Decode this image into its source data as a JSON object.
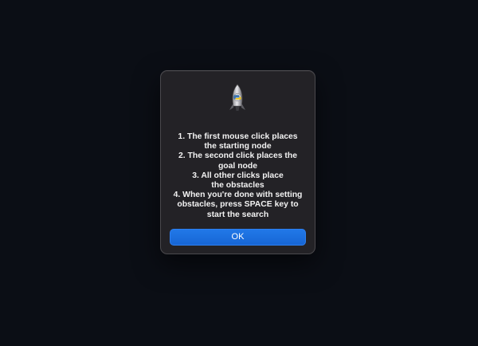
{
  "dialog": {
    "icon": "python-rocket-icon",
    "message_lines": [
      "1. The first mouse click places",
      "the starting node",
      "2. The second click places the",
      "goal node",
      "3. All other clicks place",
      "the obstacles",
      "4. When you're done with setting",
      "obstacles, press SPACE key to",
      "start the search"
    ],
    "ok_label": "OK"
  },
  "colors": {
    "background": "#0b0e15",
    "dialog": "#232226",
    "accent": "#1a6fe0",
    "text": "#f2f2f2"
  }
}
